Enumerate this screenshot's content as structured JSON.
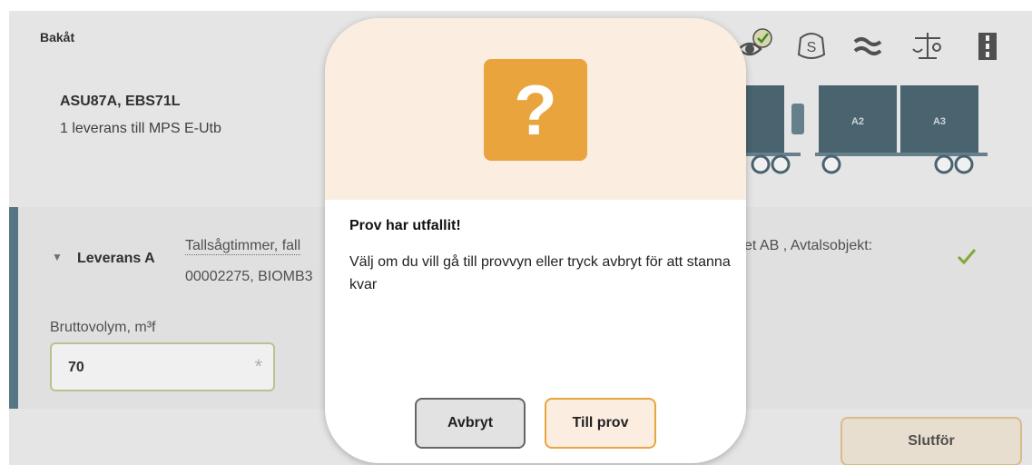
{
  "header": {
    "back_label": "Bakåt"
  },
  "toolbar": {
    "icons": [
      "eye-check-icon",
      "s-badge-icon",
      "waves-icon",
      "scale-icon",
      "road-icon"
    ],
    "accent_color": "#e9a43d"
  },
  "vehicle": {
    "title": "ASU87A, EBS71L",
    "subtitle": "1 leverans till MPS E-Utb",
    "trailer_labels": [
      "A2",
      "A3"
    ]
  },
  "delivery": {
    "toggle_icon": "▼",
    "title": "Leverans A",
    "description_line1": "Tallsågtimmer, fall",
    "description_line2": "00002275, BIOMB3",
    "description_right": "et AB , Avtalsobjekt:",
    "status": "✓"
  },
  "volume": {
    "label": "Bruttovolym, m³f",
    "value": "70",
    "required_mark": "*"
  },
  "footer": {
    "finish_label": "Slutför"
  },
  "dialog": {
    "icon": "?",
    "title": "Prov har utfallit!",
    "message": "Välj om du vill gå till provvyn eller tryck avbryt för att stanna kvar",
    "cancel_label": "Avbryt",
    "confirm_label": "Till prov"
  }
}
